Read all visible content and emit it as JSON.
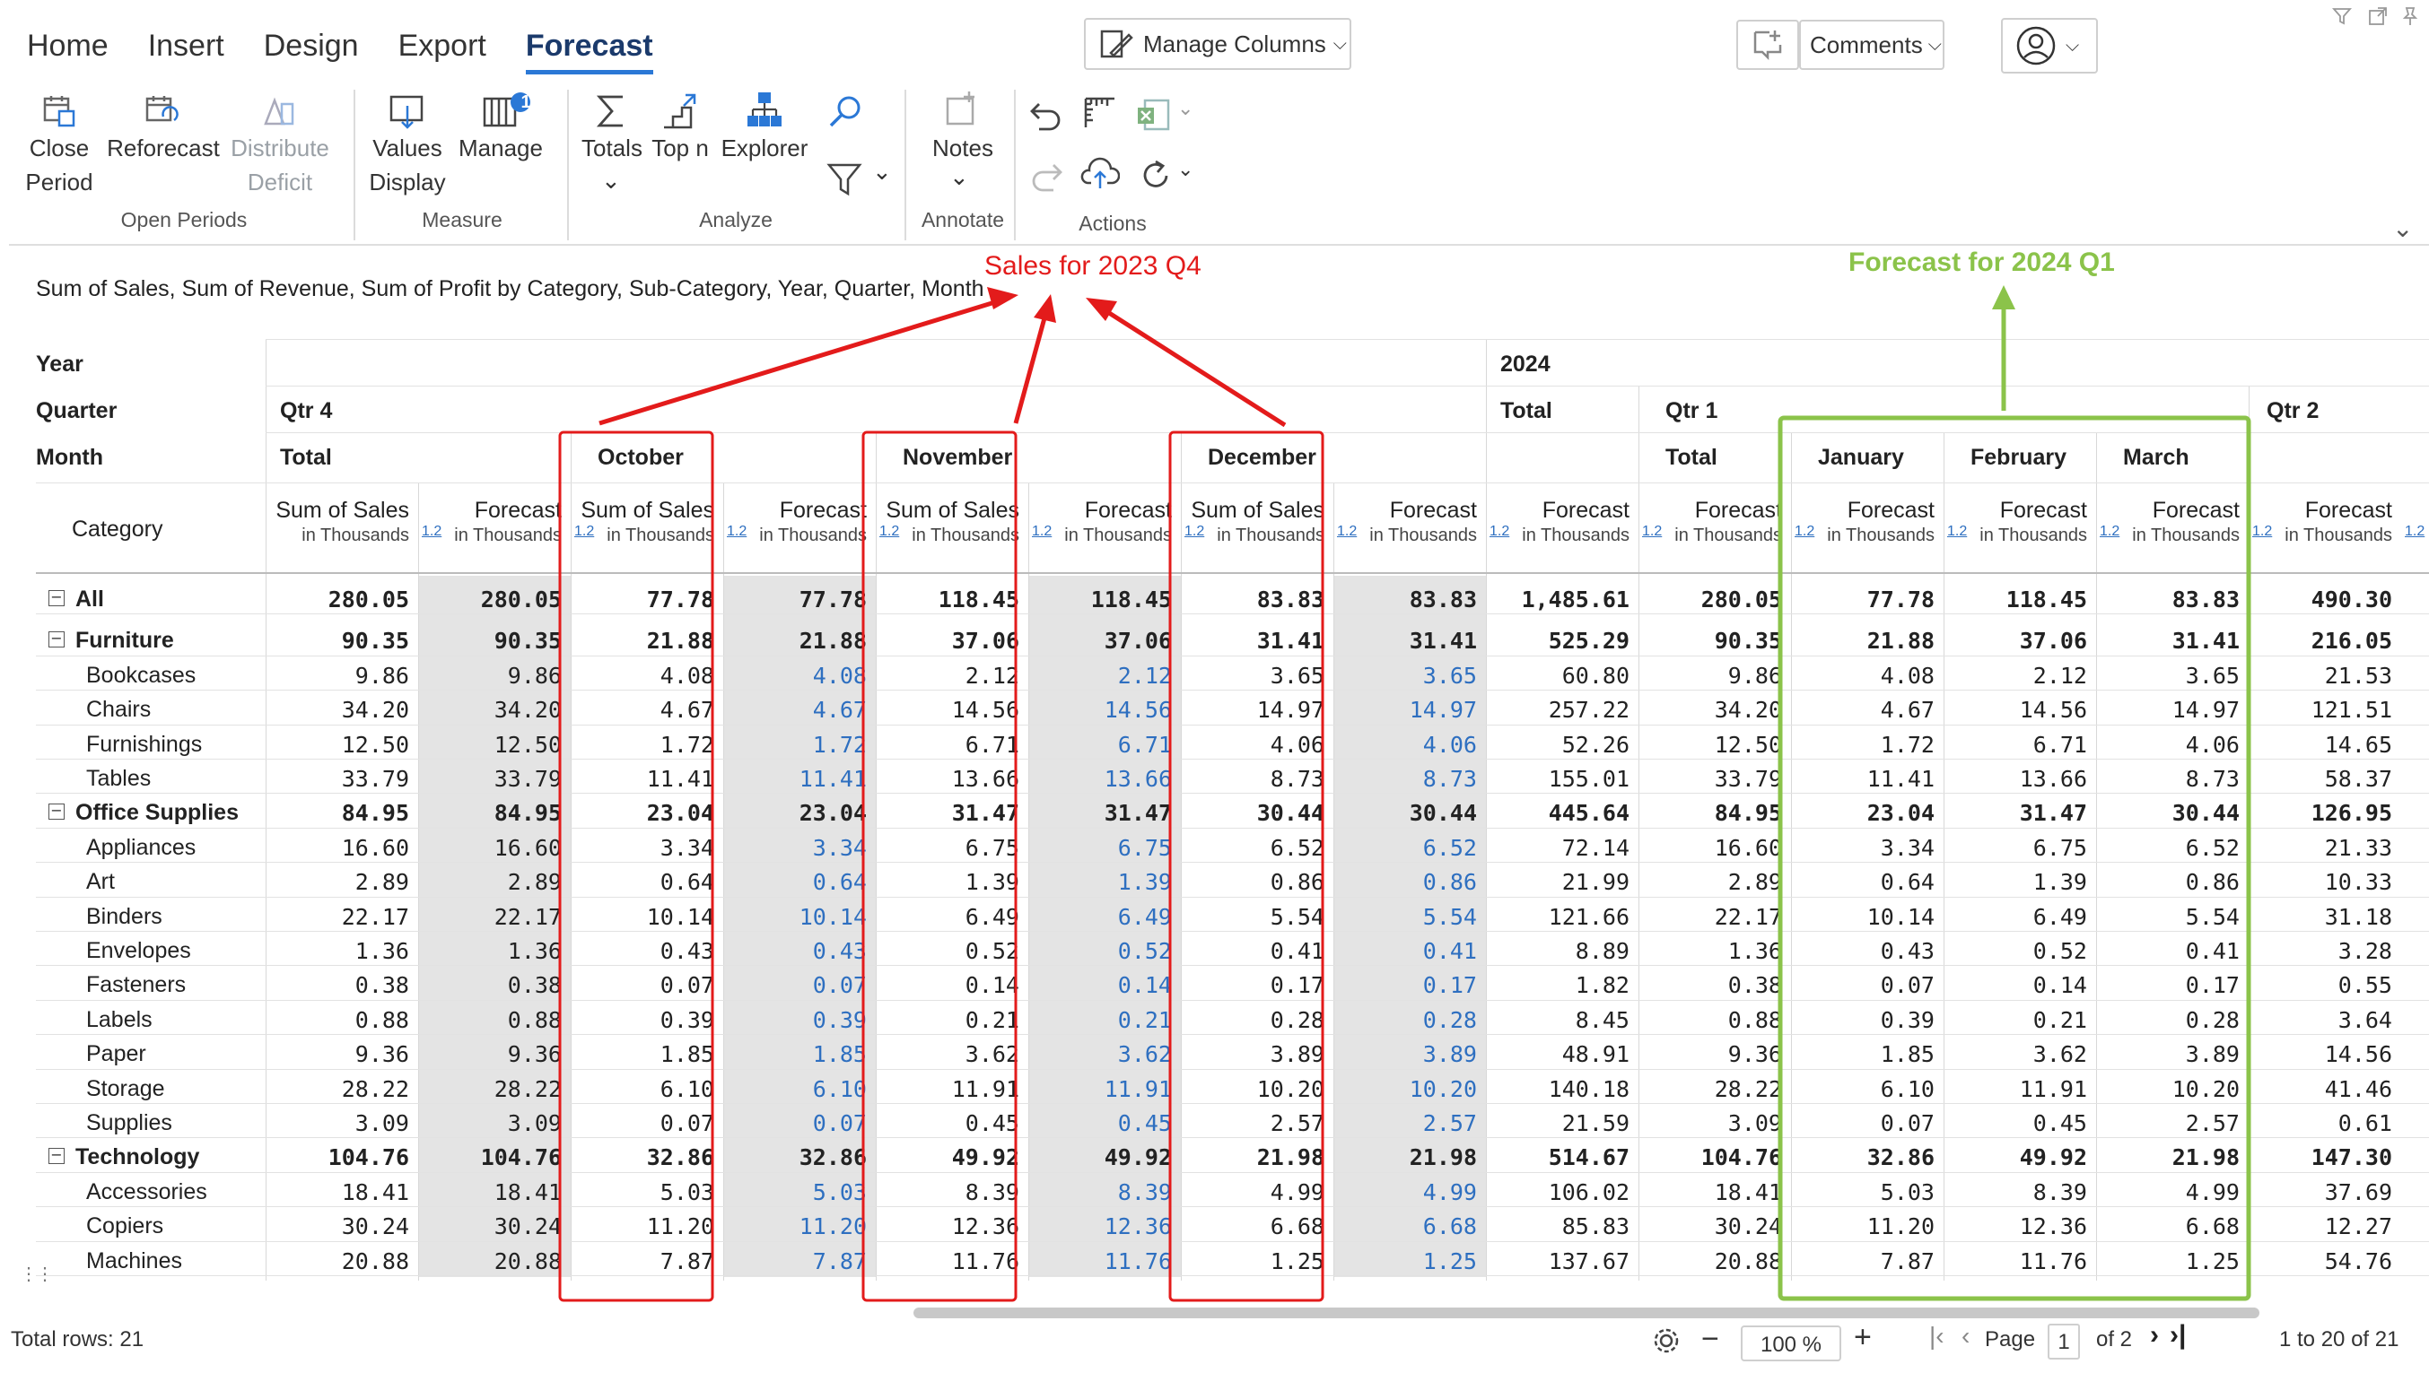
{
  "ribbon": {
    "tabs": [
      {
        "label": "Home",
        "active": false
      },
      {
        "label": "Insert",
        "active": false
      },
      {
        "label": "Design",
        "active": false
      },
      {
        "label": "Export",
        "active": false
      },
      {
        "label": "Forecast",
        "active": true
      }
    ],
    "manage_columns_label": "Manage Columns",
    "comments_label": "Comments",
    "groups": {
      "open_periods": {
        "label": "Open Periods",
        "close_period": "Close Period",
        "reforecast": "Reforecast",
        "distribute_deficit": "Distribute Deficit"
      },
      "measure": {
        "label": "Measure",
        "values_display": "Values Display",
        "manage": "Manage",
        "manage_badge": "1"
      },
      "analyze": {
        "label": "Analyze",
        "totals": "Totals",
        "top_n": "Top n",
        "explorer": "Explorer"
      },
      "annotate": {
        "label": "Annotate",
        "notes": "Notes"
      },
      "actions": {
        "label": "Actions"
      }
    }
  },
  "caption": "Sum of Sales, Sum of Revenue, Sum of Profit by Category, Sub-Category, Year, Quarter, Month",
  "annotations": {
    "sales_q4": "Sales for 2023 Q4",
    "forecast_q1": "Forecast for 2024 Q1",
    "red": "#e31b1b",
    "green": "#8bc34a"
  },
  "headers": {
    "year_label": "Year",
    "quarter_label": "Quarter",
    "month_label": "Month",
    "category_label": "Category",
    "year_2024": "2024",
    "qtr4": "Qtr 4",
    "qtr1": "Qtr 1",
    "qtr2": "Qtr 2",
    "total": "Total",
    "months": [
      "October",
      "November",
      "December",
      "January",
      "February",
      "March"
    ],
    "sum_of_sales": "Sum of Sales",
    "forecast": "Forecast",
    "in_thousands": "in Thousands",
    "tag": "1.2"
  },
  "rows": [
    {
      "label": "All",
      "level": 0,
      "bold": true,
      "expander": true,
      "v": [
        "280.05",
        "280.05",
        "77.78",
        "77.78",
        "118.45",
        "118.45",
        "83.83",
        "83.83",
        "1,485.61",
        "280.05",
        "77.78",
        "118.45",
        "83.83",
        "490.30"
      ]
    },
    {
      "label": "Furniture",
      "level": 1,
      "bold": true,
      "expander": true,
      "v": [
        "90.35",
        "90.35",
        "21.88",
        "21.88",
        "37.06",
        "37.06",
        "31.41",
        "31.41",
        "525.29",
        "90.35",
        "21.88",
        "37.06",
        "31.41",
        "216.05"
      ]
    },
    {
      "label": "Bookcases",
      "level": 2,
      "bold": false,
      "v": [
        "9.86",
        "9.86",
        "4.08",
        "4.08",
        "2.12",
        "2.12",
        "3.65",
        "3.65",
        "60.80",
        "9.86",
        "4.08",
        "2.12",
        "3.65",
        "21.53"
      ]
    },
    {
      "label": "Chairs",
      "level": 2,
      "bold": false,
      "v": [
        "34.20",
        "34.20",
        "4.67",
        "4.67",
        "14.56",
        "14.56",
        "14.97",
        "14.97",
        "257.22",
        "34.20",
        "4.67",
        "14.56",
        "14.97",
        "121.51"
      ]
    },
    {
      "label": "Furnishings",
      "level": 2,
      "bold": false,
      "v": [
        "12.50",
        "12.50",
        "1.72",
        "1.72",
        "6.71",
        "6.71",
        "4.06",
        "4.06",
        "52.26",
        "12.50",
        "1.72",
        "6.71",
        "4.06",
        "14.65"
      ]
    },
    {
      "label": "Tables",
      "level": 2,
      "bold": false,
      "v": [
        "33.79",
        "33.79",
        "11.41",
        "11.41",
        "13.66",
        "13.66",
        "8.73",
        "8.73",
        "155.01",
        "33.79",
        "11.41",
        "13.66",
        "8.73",
        "58.37"
      ]
    },
    {
      "label": "Office Supplies",
      "level": 1,
      "bold": true,
      "expander": true,
      "v": [
        "84.95",
        "84.95",
        "23.04",
        "23.04",
        "31.47",
        "31.47",
        "30.44",
        "30.44",
        "445.64",
        "84.95",
        "23.04",
        "31.47",
        "30.44",
        "126.95"
      ]
    },
    {
      "label": "Appliances",
      "level": 2,
      "bold": false,
      "v": [
        "16.60",
        "16.60",
        "3.34",
        "3.34",
        "6.75",
        "6.75",
        "6.52",
        "6.52",
        "72.14",
        "16.60",
        "3.34",
        "6.75",
        "6.52",
        "21.33"
      ]
    },
    {
      "label": "Art",
      "level": 2,
      "bold": false,
      "v": [
        "2.89",
        "2.89",
        "0.64",
        "0.64",
        "1.39",
        "1.39",
        "0.86",
        "0.86",
        "21.99",
        "2.89",
        "0.64",
        "1.39",
        "0.86",
        "10.33"
      ]
    },
    {
      "label": "Binders",
      "level": 2,
      "bold": false,
      "v": [
        "22.17",
        "22.17",
        "10.14",
        "10.14",
        "6.49",
        "6.49",
        "5.54",
        "5.54",
        "121.66",
        "22.17",
        "10.14",
        "6.49",
        "5.54",
        "31.18"
      ]
    },
    {
      "label": "Envelopes",
      "level": 2,
      "bold": false,
      "v": [
        "1.36",
        "1.36",
        "0.43",
        "0.43",
        "0.52",
        "0.52",
        "0.41",
        "0.41",
        "8.89",
        "1.36",
        "0.43",
        "0.52",
        "0.41",
        "3.28"
      ]
    },
    {
      "label": "Fasteners",
      "level": 2,
      "bold": false,
      "v": [
        "0.38",
        "0.38",
        "0.07",
        "0.07",
        "0.14",
        "0.14",
        "0.17",
        "0.17",
        "1.82",
        "0.38",
        "0.07",
        "0.14",
        "0.17",
        "0.55"
      ]
    },
    {
      "label": "Labels",
      "level": 2,
      "bold": false,
      "v": [
        "0.88",
        "0.88",
        "0.39",
        "0.39",
        "0.21",
        "0.21",
        "0.28",
        "0.28",
        "8.45",
        "0.88",
        "0.39",
        "0.21",
        "0.28",
        "3.64"
      ]
    },
    {
      "label": "Paper",
      "level": 2,
      "bold": false,
      "v": [
        "9.36",
        "9.36",
        "1.85",
        "1.85",
        "3.62",
        "3.62",
        "3.89",
        "3.89",
        "48.91",
        "9.36",
        "1.85",
        "3.62",
        "3.89",
        "14.56"
      ]
    },
    {
      "label": "Storage",
      "level": 2,
      "bold": false,
      "v": [
        "28.22",
        "28.22",
        "6.10",
        "6.10",
        "11.91",
        "11.91",
        "10.20",
        "10.20",
        "140.18",
        "28.22",
        "6.10",
        "11.91",
        "10.20",
        "41.46"
      ]
    },
    {
      "label": "Supplies",
      "level": 2,
      "bold": false,
      "v": [
        "3.09",
        "3.09",
        "0.07",
        "0.07",
        "0.45",
        "0.45",
        "2.57",
        "2.57",
        "21.59",
        "3.09",
        "0.07",
        "0.45",
        "2.57",
        "0.61"
      ]
    },
    {
      "label": "Technology",
      "level": 1,
      "bold": true,
      "expander": true,
      "v": [
        "104.76",
        "104.76",
        "32.86",
        "32.86",
        "49.92",
        "49.92",
        "21.98",
        "21.98",
        "514.67",
        "104.76",
        "32.86",
        "49.92",
        "21.98",
        "147.30"
      ]
    },
    {
      "label": "Accessories",
      "level": 2,
      "bold": false,
      "v": [
        "18.41",
        "18.41",
        "5.03",
        "5.03",
        "8.39",
        "8.39",
        "4.99",
        "4.99",
        "106.02",
        "18.41",
        "5.03",
        "8.39",
        "4.99",
        "37.69"
      ]
    },
    {
      "label": "Copiers",
      "level": 2,
      "bold": false,
      "v": [
        "30.24",
        "30.24",
        "11.20",
        "11.20",
        "12.36",
        "12.36",
        "6.68",
        "6.68",
        "85.83",
        "30.24",
        "11.20",
        "12.36",
        "6.68",
        "12.27"
      ]
    },
    {
      "label": "Machines",
      "level": 2,
      "bold": false,
      "v": [
        "20.88",
        "20.88",
        "7.87",
        "7.87",
        "11.76",
        "11.76",
        "1.25",
        "1.25",
        "137.67",
        "20.88",
        "7.87",
        "11.76",
        "1.25",
        "54.76"
      ]
    }
  ],
  "colors": {
    "forecast_blue": "#2e6fc0",
    "shade": "#e4e4e4"
  },
  "footer": {
    "total_rows": "Total rows: 21",
    "zoom": "100 %",
    "page_label": "Page",
    "page_value": "1",
    "of_pages": "of 2",
    "range": "1 to 20 of 21"
  }
}
